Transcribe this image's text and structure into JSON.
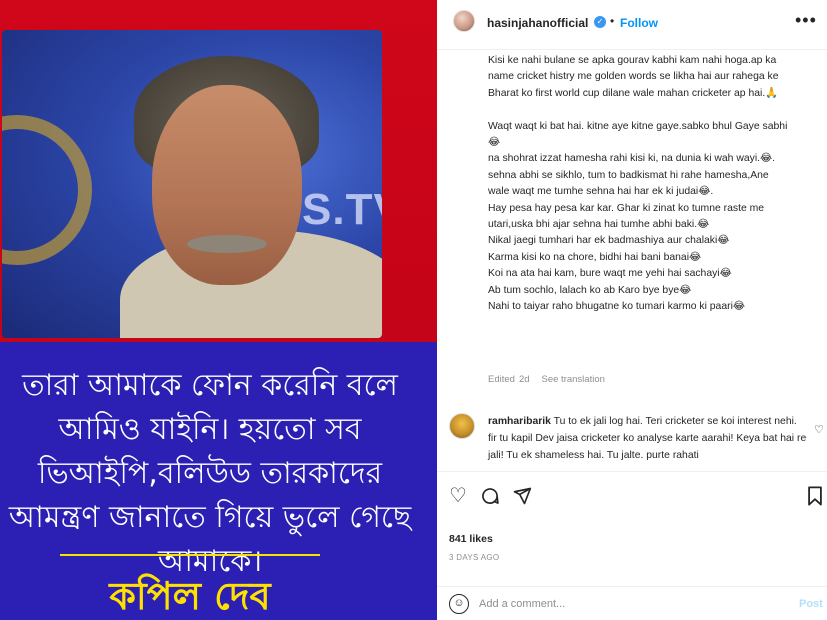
{
  "post_image": {
    "photo_logo_text": "S.TV",
    "bengali_quote": "তারা আমাকে ফোন করেনি বলে আমিও যাইনি। হয়তো সব ভিআইপি,বলিউড তারকাদের আমন্ত্রণ জানাতে গিয়ে ভুলে গেছে আমাকে।",
    "bengali_name": "কপিল দেব",
    "colors": {
      "background": "#c50418",
      "panel": "#2c1fb3",
      "name": "#ffe100"
    }
  },
  "header": {
    "username": "hasinjahanofficial",
    "verified_icon": "verified-badge-icon",
    "separator": "•",
    "follow_label": "Follow",
    "more_icon": "more-horizontal-icon"
  },
  "caption": {
    "text": "Kisi ke nahi bulane se apka gourav kabhi kam nahi hoga.ap ka\nname cricket histry me golden words se likha hai aur rahega ke\nBharat ko first world cup dilane wale mahan cricketer ap hai.🙏\n\nWaqt waqt ki bat hai. kitne aye kitne gaye.sabko bhul Gaye sabhi\n😂\nna shohrat izzat hamesha rahi kisi ki, na dunia ki wah wayi.😂.\nsehna abhi se sikhlo, tum to badkismat hi rahe hamesha,Ane\nwale waqt me tumhe sehna hai har ek ki judai😂.\nHay pesa hay pesa kar kar. Ghar ki zinat ko tumne raste me\nutari,uska bhi ajar sehna hai tumhe abhi baki.😂\nNikal jaegi tumhari har ek badmashiya aur chalaki😂\nKarma kisi ko na chore, bidhi hai bani banai😂\nKoi na ata hai kam, bure waqt me yehi hai sachayi😂\nAb tum sochlo, lalach ko ab Karo bye bye😂\nNahi to taiyar raho bhugatne ko tumari karmo ki paari😂",
    "edited": "Edited",
    "time": "2d",
    "see_translation": "See translation"
  },
  "comment": {
    "username": "ramharibarik",
    "text": "Tu to ek jali log hai. Teri cricketer se koi interest nehi. fir tu kapil Dev jaisa cricketer ko analyse karte aarahi! Keya bat hai re jali! Tu ek shameless hai. Tu jalte. purte rahati",
    "like_icon": "heart-outline-icon"
  },
  "actions": {
    "like_icon": "heart-icon",
    "comment_icon": "comment-bubble-icon",
    "share_icon": "paper-plane-icon",
    "save_icon": "bookmark-icon",
    "likes": "841 likes",
    "date": "3 DAYS AGO"
  },
  "add_comment": {
    "emoji_icon": "emoji-smiley-icon",
    "placeholder": "Add a comment...",
    "post_label": "Post"
  }
}
